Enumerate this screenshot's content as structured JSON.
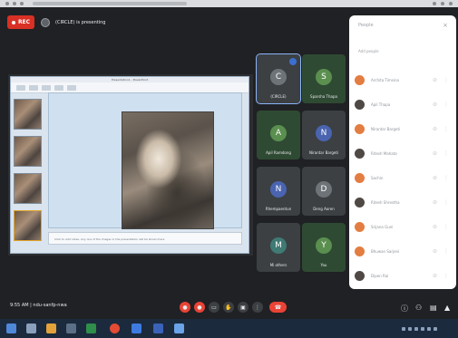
{
  "header": {
    "rec_label": "REC",
    "presenting_label": "(CIRCLE) is presenting"
  },
  "presentation": {
    "window_title": "Presentation1 - PowerPoint",
    "notes_text": "Click to add notes. Any one of the images in the presentation will be shown here."
  },
  "tiles": [
    {
      "name": "(CIRCLE)",
      "initial": "C"
    },
    {
      "name": "Sparsha Thapa",
      "initial": "S"
    },
    {
      "name": "Apil Ramdong",
      "initial": "A"
    },
    {
      "name": "Nirantar Bargeti",
      "initial": "N"
    },
    {
      "name": "Rhempaentun",
      "initial": "N"
    },
    {
      "name": "Deng Aoren",
      "initial": "D"
    },
    {
      "name": "Mi others",
      "initial": "M"
    },
    {
      "name": "You",
      "initial": "Y"
    }
  ],
  "people_panel": {
    "title": "People",
    "subtitle": "Add people",
    "close_label": "×",
    "participants": [
      {
        "name": "Archita Timsina"
      },
      {
        "name": "Apil Thapa"
      },
      {
        "name": "Nirantar Bargeti"
      },
      {
        "name": "Ritesh Mahata"
      },
      {
        "name": "Sachin"
      },
      {
        "name": "Ritesh Shrestha"
      },
      {
        "name": "Srijana Guni"
      },
      {
        "name": "Bhuwan Sarjeni"
      },
      {
        "name": "Dipen Rai"
      }
    ]
  },
  "bottom": {
    "time_label": "9:55 AM | ndu-sanfp-nwa"
  },
  "colors": {
    "rec": "#d93025",
    "end_call": "#ea4335",
    "panel_bg": "#ffffff",
    "dark_bg": "#202124",
    "taskbar": "#1c2a3d"
  }
}
